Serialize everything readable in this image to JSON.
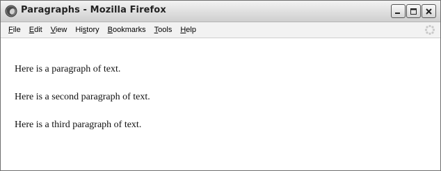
{
  "window": {
    "title": "Paragraphs - Mozilla Firefox"
  },
  "menu": {
    "items": [
      {
        "accel": "F",
        "rest": "ile"
      },
      {
        "accel": "E",
        "rest": "dit"
      },
      {
        "accel": "V",
        "rest": "iew"
      },
      {
        "pre": "Hi",
        "accel": "s",
        "rest": "tory"
      },
      {
        "accel": "B",
        "rest": "ookmarks"
      },
      {
        "accel": "T",
        "rest": "ools"
      },
      {
        "accel": "H",
        "rest": "elp"
      }
    ]
  },
  "content": {
    "paragraphs": [
      "Here is a paragraph of text.",
      "Here is a second paragraph of text.",
      "Here is a third paragraph of text."
    ]
  },
  "icons": {
    "app": "firefox-icon",
    "minimize": "minimize-icon",
    "maximize": "maximize-icon",
    "close": "close-icon",
    "throbber": "throbber-icon"
  },
  "colors": {
    "titlebar_top": "#f3f3f3",
    "titlebar_bottom": "#cfcfcf",
    "menubar_bg": "#f2f2f2",
    "content_bg": "#ffffff"
  }
}
